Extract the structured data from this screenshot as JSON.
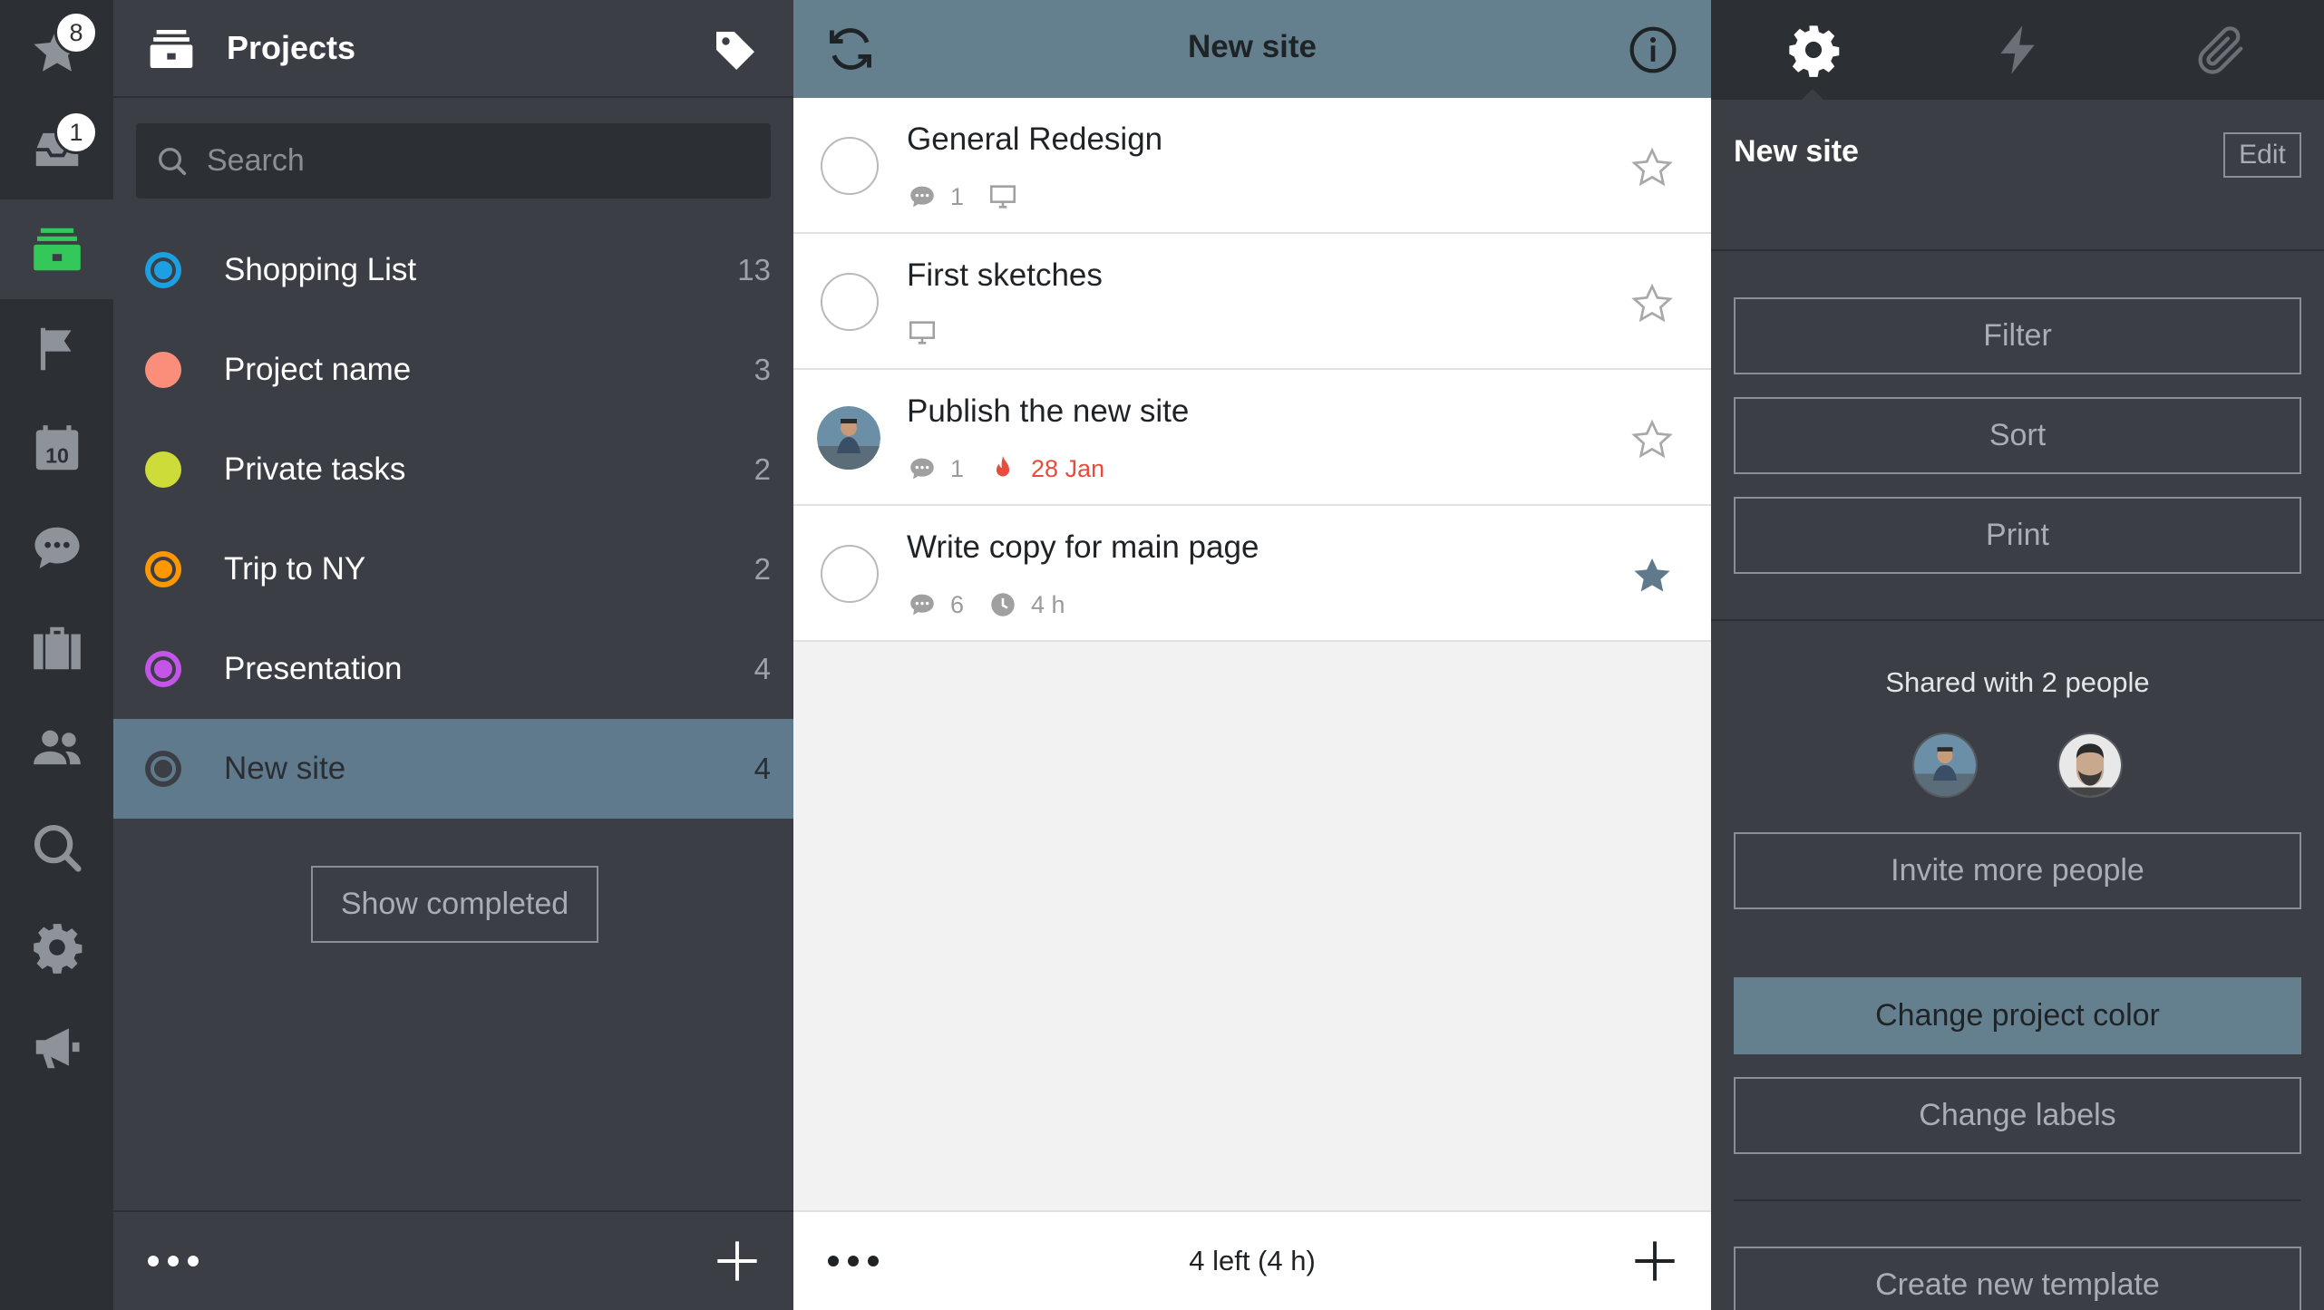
{
  "rail": {
    "items": [
      {
        "icon": "star-icon",
        "badge": "8"
      },
      {
        "icon": "inbox-icon",
        "badge": "1"
      },
      {
        "icon": "projects-icon",
        "active": true
      },
      {
        "icon": "flag-icon"
      },
      {
        "icon": "calendar-icon",
        "calendar_day": "10"
      },
      {
        "icon": "comments-icon"
      },
      {
        "icon": "briefcase-icon"
      },
      {
        "icon": "people-icon"
      },
      {
        "icon": "search-icon"
      },
      {
        "icon": "gear-icon"
      },
      {
        "icon": "megaphone-icon"
      }
    ]
  },
  "projects": {
    "title": "Projects",
    "search_placeholder": "Search",
    "items": [
      {
        "name": "Shopping List",
        "count": "13",
        "color": "#1ba1e2",
        "style": "ring"
      },
      {
        "name": "Project name",
        "count": "3",
        "color": "#fa8e7a",
        "style": "solid"
      },
      {
        "name": "Private tasks",
        "count": "2",
        "color": "#cddc39",
        "style": "solid"
      },
      {
        "name": "Trip to NY",
        "count": "2",
        "color": "#ff9800",
        "style": "ring"
      },
      {
        "name": "Presentation",
        "count": "4",
        "color": "#c455e8",
        "style": "ring"
      },
      {
        "name": "New site",
        "count": "4",
        "color": "#3b3f45",
        "style": "ring",
        "selected": true
      }
    ],
    "show_completed_label": "Show completed"
  },
  "tasks": {
    "title": "New site",
    "items": [
      {
        "title": "General Redesign",
        "comments": "1",
        "has_note": true,
        "starred": false
      },
      {
        "title": "First sketches",
        "has_note": true,
        "starred": false
      },
      {
        "title": "Publish the new site",
        "comments": "1",
        "due": "28 Jan",
        "assigned": true,
        "starred": false
      },
      {
        "title": "Write copy for main page",
        "comments": "6",
        "duration": "4 h",
        "starred": true
      }
    ],
    "footer_text": "4 left (4 h)"
  },
  "details": {
    "tabs": [
      "gear-icon",
      "lightning-icon",
      "paperclip-icon"
    ],
    "project_title": "New site",
    "edit_label": "Edit",
    "filter_label": "Filter",
    "sort_label": "Sort",
    "print_label": "Print",
    "shared_text": "Shared with 2 people",
    "invite_label": "Invite more people",
    "change_color_label": "Change project color",
    "change_labels_label": "Change labels",
    "create_template_label": "Create new template"
  },
  "colors": {
    "rail_bg": "#2c2f33",
    "panel_bg": "#3b3f45",
    "accent": "#64808f",
    "active_green": "#34c759",
    "due_red": "#e84c3d",
    "star_filled": "#5f7a8c"
  }
}
